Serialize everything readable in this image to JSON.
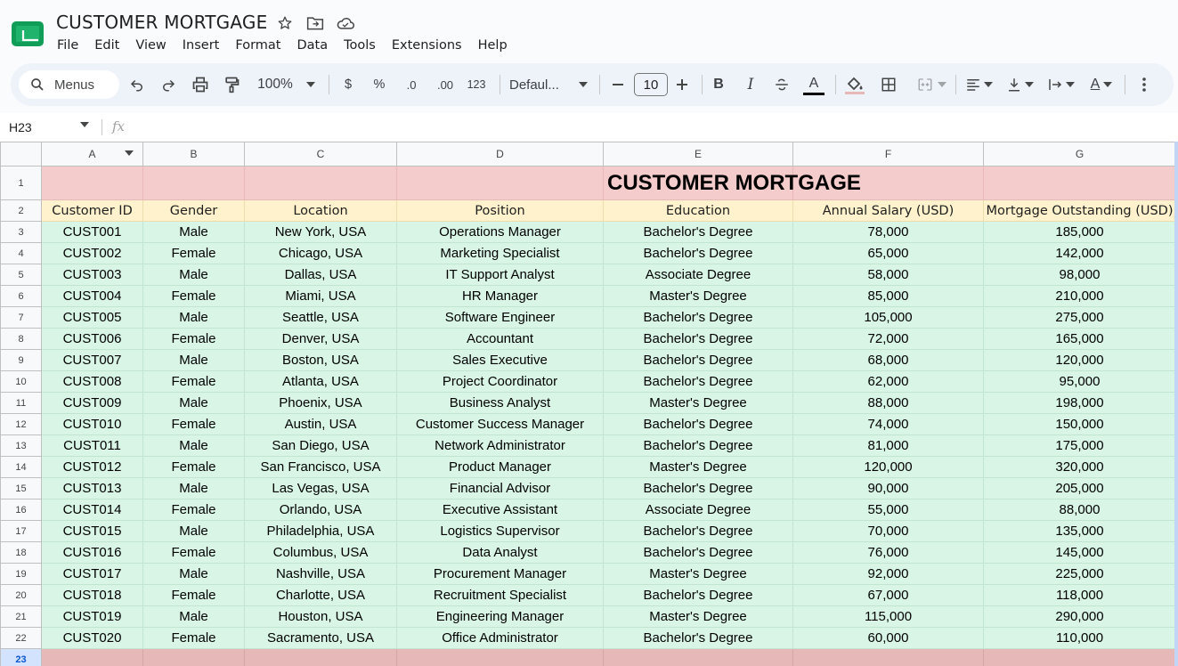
{
  "doc": {
    "title": "CUSTOMER MORTGAGE"
  },
  "menu": [
    "File",
    "Edit",
    "View",
    "Insert",
    "Format",
    "Data",
    "Tools",
    "Extensions",
    "Help"
  ],
  "toolbar": {
    "search_label": "Menus",
    "zoom": "100%",
    "currency": "$",
    "percent": "%",
    "decrease_decimal": ".0",
    "increase_decimal": ".00",
    "more_formats": "123",
    "font": "Defaul...",
    "font_size": "10",
    "bold": "B",
    "italic": "I",
    "text_color_letter": "A",
    "text_rotation_letter": "A"
  },
  "colors": {
    "title_row": "#f4cccc",
    "header_row": "#fff2cc",
    "data_rows": "#d9f5e6",
    "last_row": "#e6b8b7",
    "selection": "#1a73e8"
  },
  "formula_bar": {
    "cell_ref": "H23",
    "fx": "fx"
  },
  "grid": {
    "column_letters": [
      "A",
      "B",
      "C",
      "D",
      "E",
      "F",
      "G"
    ],
    "row_numbers": [
      "1",
      "2",
      "3",
      "4",
      "5",
      "6",
      "7",
      "8",
      "9",
      "10",
      "11",
      "12",
      "13",
      "14",
      "15",
      "16",
      "17",
      "18",
      "19",
      "20",
      "21",
      "22",
      "23"
    ],
    "sheet_title": "CUSTOMER MORTGAGE",
    "headers": [
      "Customer ID",
      "Gender",
      "Location",
      "Position",
      "Education",
      "Annual Salary (USD)",
      "Mortgage Outstanding (USD)"
    ],
    "rows": [
      [
        "CUST001",
        "Male",
        "New York, USA",
        "Operations Manager",
        "Bachelor's Degree",
        "78,000",
        "185,000"
      ],
      [
        "CUST002",
        "Female",
        "Chicago, USA",
        "Marketing Specialist",
        "Bachelor's Degree",
        "65,000",
        "142,000"
      ],
      [
        "CUST003",
        "Male",
        "Dallas, USA",
        "IT Support Analyst",
        "Associate Degree",
        "58,000",
        "98,000"
      ],
      [
        "CUST004",
        "Female",
        "Miami, USA",
        "HR Manager",
        "Master's Degree",
        "85,000",
        "210,000"
      ],
      [
        "CUST005",
        "Male",
        "Seattle, USA",
        "Software Engineer",
        "Bachelor's Degree",
        "105,000",
        "275,000"
      ],
      [
        "CUST006",
        "Female",
        "Denver, USA",
        "Accountant",
        "Bachelor's Degree",
        "72,000",
        "165,000"
      ],
      [
        "CUST007",
        "Male",
        "Boston, USA",
        "Sales Executive",
        "Bachelor's Degree",
        "68,000",
        "120,000"
      ],
      [
        "CUST008",
        "Female",
        "Atlanta, USA",
        "Project Coordinator",
        "Bachelor's Degree",
        "62,000",
        "95,000"
      ],
      [
        "CUST009",
        "Male",
        "Phoenix, USA",
        "Business Analyst",
        "Master's Degree",
        "88,000",
        "198,000"
      ],
      [
        "CUST010",
        "Female",
        "Austin, USA",
        "Customer Success Manager",
        "Bachelor's Degree",
        "74,000",
        "150,000"
      ],
      [
        "CUST011",
        "Male",
        "San Diego, USA",
        "Network Administrator",
        "Bachelor's Degree",
        "81,000",
        "175,000"
      ],
      [
        "CUST012",
        "Female",
        "San Francisco, USA",
        "Product Manager",
        "Master's Degree",
        "120,000",
        "320,000"
      ],
      [
        "CUST013",
        "Male",
        "Las Vegas, USA",
        "Financial Advisor",
        "Bachelor's Degree",
        "90,000",
        "205,000"
      ],
      [
        "CUST014",
        "Female",
        "Orlando, USA",
        "Executive Assistant",
        "Associate Degree",
        "55,000",
        "88,000"
      ],
      [
        "CUST015",
        "Male",
        "Philadelphia, USA",
        "Logistics Supervisor",
        "Bachelor's Degree",
        "70,000",
        "135,000"
      ],
      [
        "CUST016",
        "Female",
        "Columbus, USA",
        "Data Analyst",
        "Bachelor's Degree",
        "76,000",
        "145,000"
      ],
      [
        "CUST017",
        "Male",
        "Nashville, USA",
        "Procurement Manager",
        "Master's Degree",
        "92,000",
        "225,000"
      ],
      [
        "CUST018",
        "Female",
        "Charlotte, USA",
        "Recruitment Specialist",
        "Bachelor's Degree",
        "67,000",
        "118,000"
      ],
      [
        "CUST019",
        "Male",
        "Houston, USA",
        "Engineering Manager",
        "Master's Degree",
        "115,000",
        "290,000"
      ],
      [
        "CUST020",
        "Female",
        "Sacramento, USA",
        "Office Administrator",
        "Bachelor's Degree",
        "60,000",
        "110,000"
      ]
    ]
  }
}
